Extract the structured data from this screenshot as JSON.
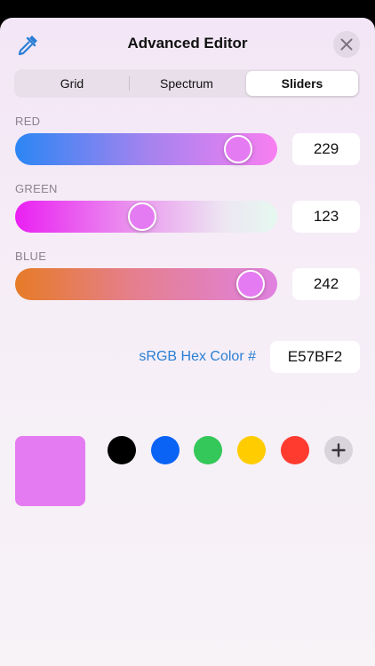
{
  "header": {
    "title": "Advanced Editor",
    "eyedropper_icon": "eyedropper-icon",
    "close_icon": "close-icon"
  },
  "tabs": [
    {
      "label": "Grid",
      "active": false
    },
    {
      "label": "Spectrum",
      "active": false
    },
    {
      "label": "Sliders",
      "active": true
    }
  ],
  "sliders": {
    "red": {
      "label": "RED",
      "value": "229",
      "max": 255
    },
    "green": {
      "label": "GREEN",
      "value": "123",
      "max": 255
    },
    "blue": {
      "label": "BLUE",
      "value": "242",
      "max": 255
    }
  },
  "hex": {
    "label": "sRGB Hex Color #",
    "value": "E57BF2"
  },
  "preview_color": "#e57bf2",
  "swatches": [
    {
      "name": "black",
      "color": "#000000"
    },
    {
      "name": "blue",
      "color": "#0a63f5"
    },
    {
      "name": "green",
      "color": "#34c759"
    },
    {
      "name": "yellow",
      "color": "#ffcc00"
    },
    {
      "name": "red",
      "color": "#ff3b30"
    }
  ],
  "add_icon": "plus-icon"
}
